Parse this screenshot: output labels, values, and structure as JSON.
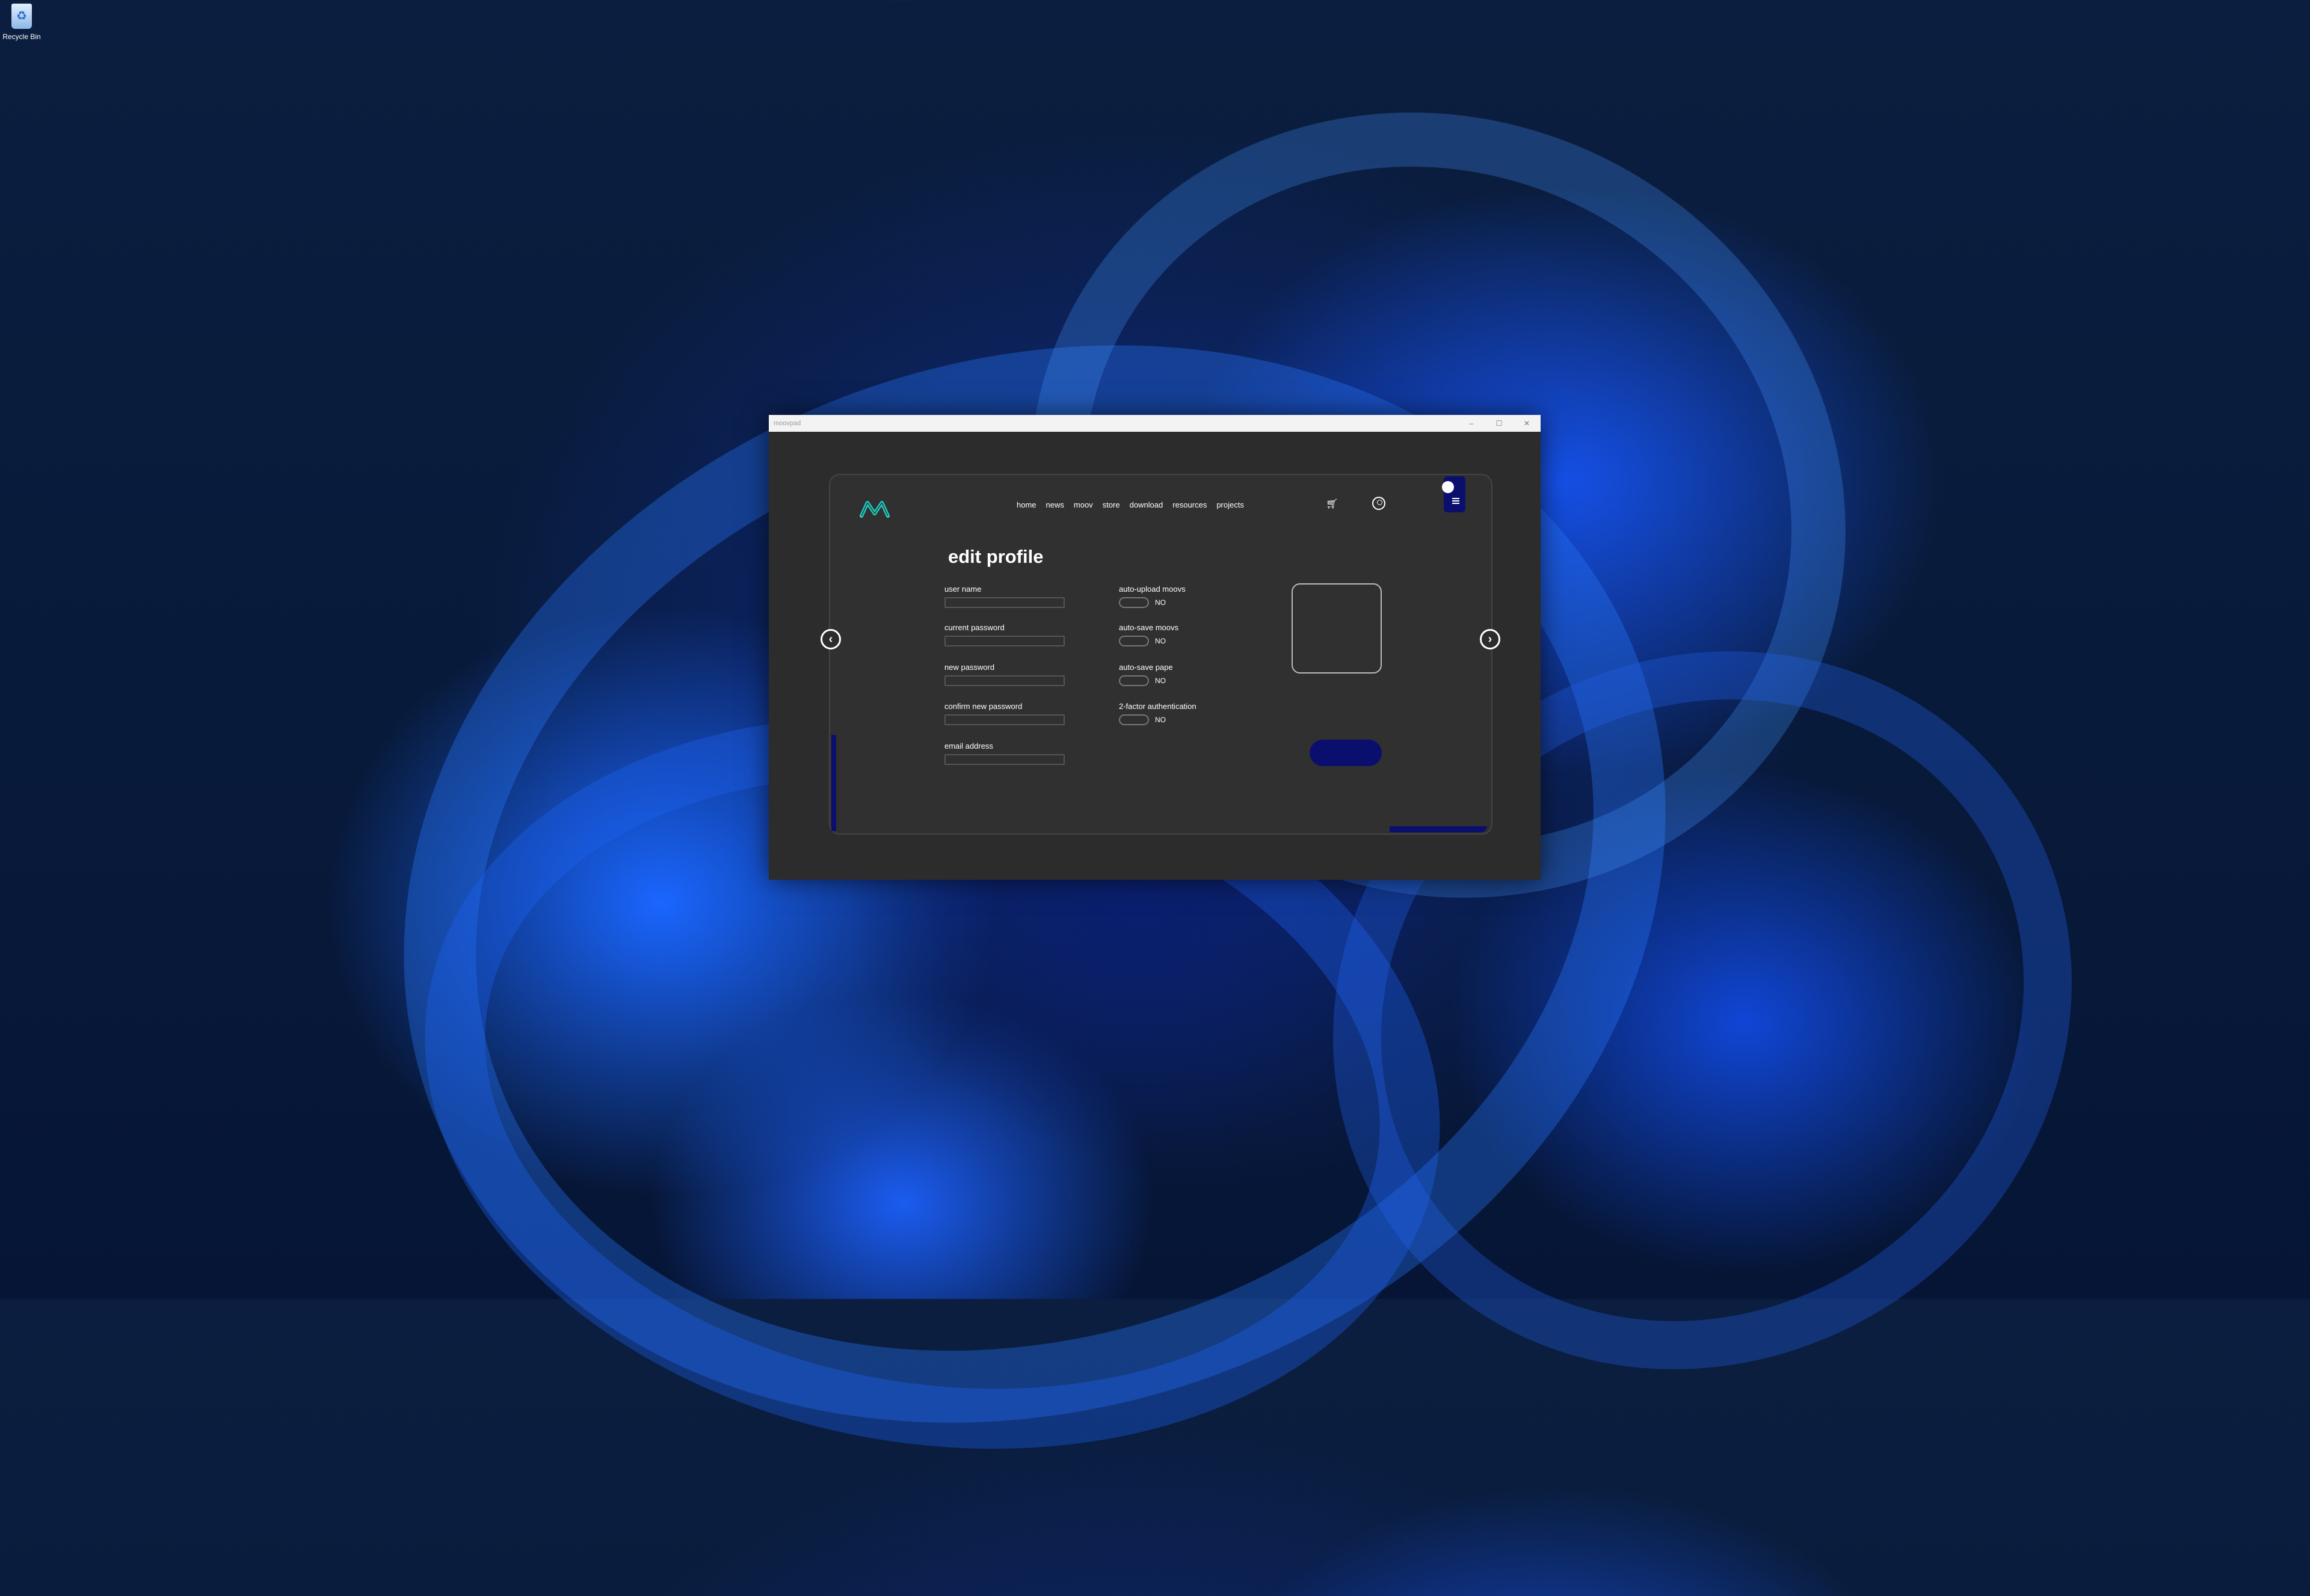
{
  "desktop": {
    "recycle_bin_label": "Recycle Bin"
  },
  "window": {
    "title": "moovpad",
    "controls": {
      "minimize": "–",
      "maximize": "☐",
      "close": "✕"
    }
  },
  "nav": {
    "items": [
      "home",
      "news",
      "moov",
      "store",
      "download",
      "resources",
      "projects"
    ]
  },
  "page": {
    "title": "edit profile"
  },
  "form": {
    "fields": [
      {
        "label": "user name",
        "value": ""
      },
      {
        "label": "current password",
        "value": ""
      },
      {
        "label": "new password",
        "value": ""
      },
      {
        "label": "confirm new password",
        "value": ""
      },
      {
        "label": "email address",
        "value": ""
      }
    ]
  },
  "options": [
    {
      "label": "auto-upload moovs",
      "state": "NO"
    },
    {
      "label": "auto-save moovs",
      "state": "NO"
    },
    {
      "label": "auto-save pape",
      "state": "NO"
    },
    {
      "label": "2-factor authentication",
      "state": "NO"
    }
  ],
  "colors": {
    "accent": "#0a0f6e",
    "logo": "#2ad4c8",
    "panel": "#303030"
  }
}
